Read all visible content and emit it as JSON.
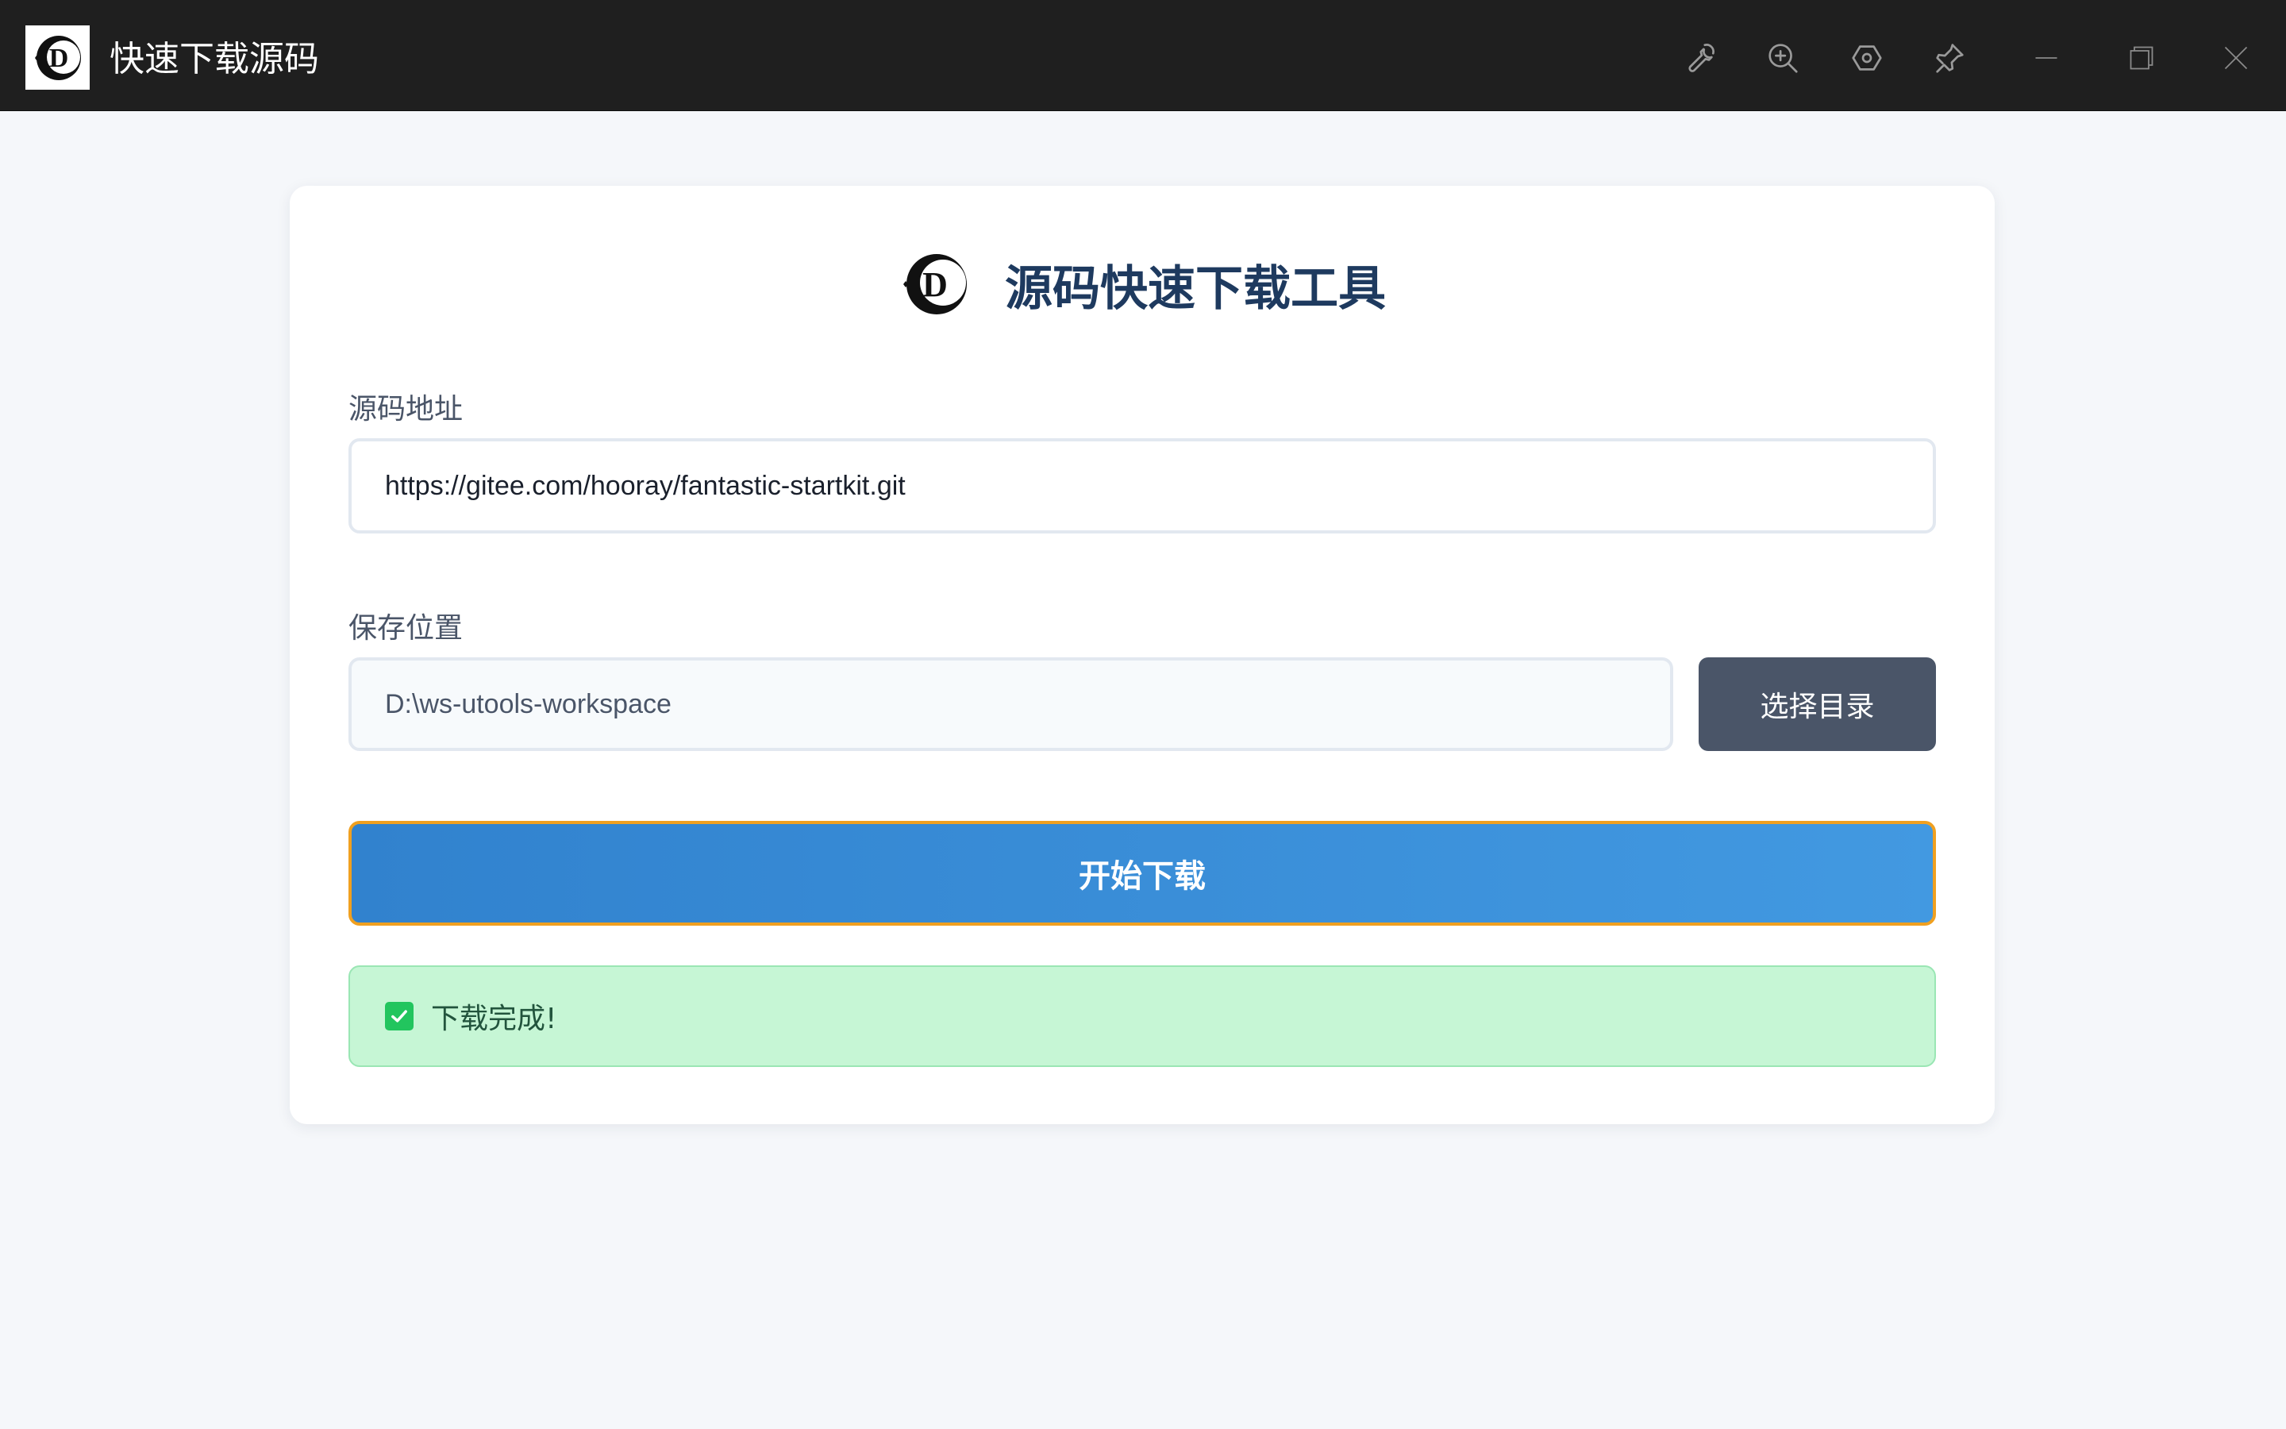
{
  "window": {
    "title": "快速下载源码",
    "toolbar_icons": [
      "wrench-icon",
      "zoom-in-icon",
      "settings-icon",
      "pin-icon"
    ],
    "window_controls": [
      "minimize-icon",
      "restore-icon",
      "close-icon"
    ]
  },
  "main": {
    "heading": "源码快速下载工具",
    "source": {
      "label": "源码地址",
      "value": "https://gitee.com/hooray/fantastic-startkit.git"
    },
    "save": {
      "label": "保存位置",
      "value": "D:\\ws-utools-workspace",
      "choose_label": "选择目录"
    },
    "start_label": "开始下载",
    "status": {
      "text": "下载完成!",
      "type": "success"
    }
  },
  "colors": {
    "titlebar": "#1f1f1f",
    "heading": "#1e3a5f",
    "accent": "#3182ce",
    "focus_border": "#f0a020",
    "success_bg": "#c6f6d5",
    "success_icon": "#22c55e"
  }
}
